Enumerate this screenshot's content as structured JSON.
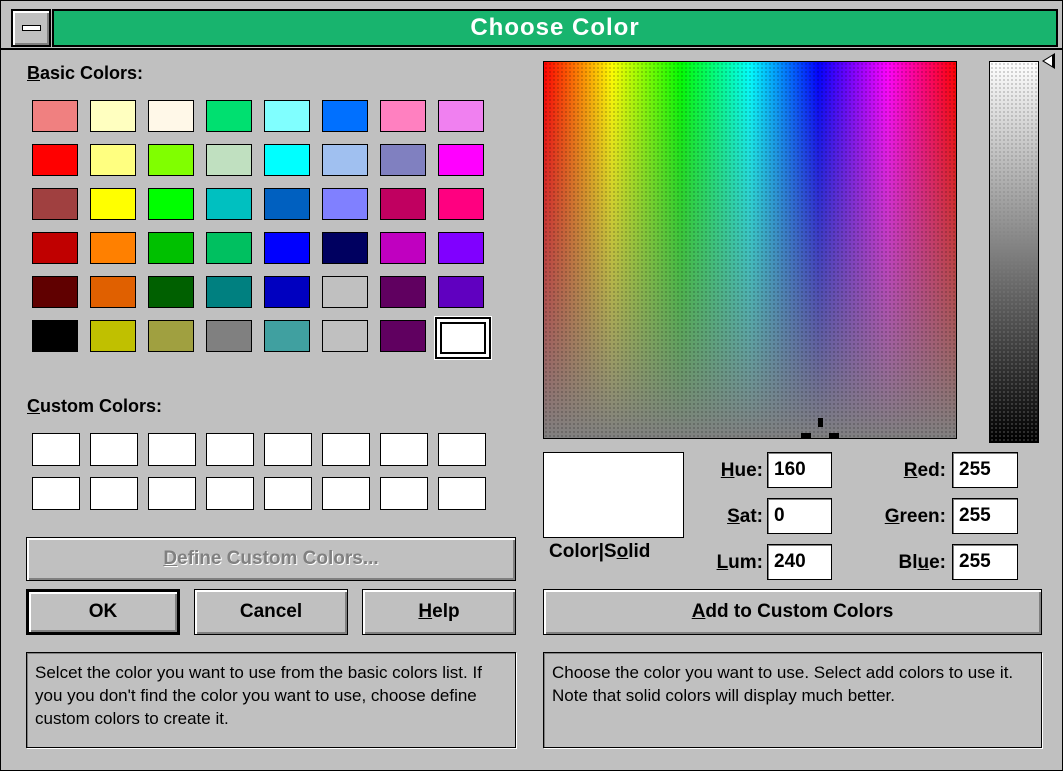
{
  "window": {
    "title": "Choose Color",
    "system_menu_icon": "minus-bar-icon"
  },
  "basic_colors": {
    "label": "Basic Colors:",
    "swatches": [
      [
        "#f08080",
        "#ffffc0",
        "#fff8e8",
        "#00e070",
        "#80ffff",
        "#0070ff",
        "#ff80c0",
        "#f080f0"
      ],
      [
        "#ff0000",
        "#ffff80",
        "#80ff00",
        "#c0e0c0",
        "#00ffff",
        "#a0c0f0",
        "#8080c0",
        "#ff00ff"
      ],
      [
        "#a04040",
        "#ffff00",
        "#00ff00",
        "#00c0c0",
        "#0060c0",
        "#8080ff",
        "#c00060",
        "#ff0080"
      ],
      [
        "#c00000",
        "#ff8000",
        "#00c000",
        "#00c060",
        "#0000ff",
        "#000060",
        "#c000c0",
        "#8000ff"
      ],
      [
        "#600000",
        "#e06000",
        "#006000",
        "#008080",
        "#0000c0",
        "#c0c0c0",
        "#600060",
        "#6000c0"
      ],
      [
        "#000000",
        "#c0c000",
        "#a0a040",
        "#808080",
        "#40a0a0",
        "#c0c0c0",
        "#600060",
        "#ffffff"
      ]
    ],
    "selected": "white"
  },
  "custom_colors": {
    "label": "Custom Colors:",
    "count": 16
  },
  "buttons": {
    "define": "Define Custom Colors...",
    "ok": "OK",
    "cancel": "Cancel",
    "help": "Help",
    "add": "Add to Custom Colors"
  },
  "fields": {
    "hue_label": "Hue:",
    "hue": "160",
    "sat_label": "Sat:",
    "sat": "0",
    "lum_label": "Lum:",
    "lum": "240",
    "red_label": "Red:",
    "red": "255",
    "green_label": "Green:",
    "green": "255",
    "blue_label": "Blue:",
    "blue": "255"
  },
  "preview": {
    "label": "Color|Solid",
    "color": "#ffffff"
  },
  "help_text": {
    "left": "Selcet the color you want to use from the basic colors list.  If you you don't find the color you want to use, choose define custom colors to create it.",
    "right": "Choose the color you want to use.  Select add colors to use it.  Note that solid colors will display much better."
  }
}
